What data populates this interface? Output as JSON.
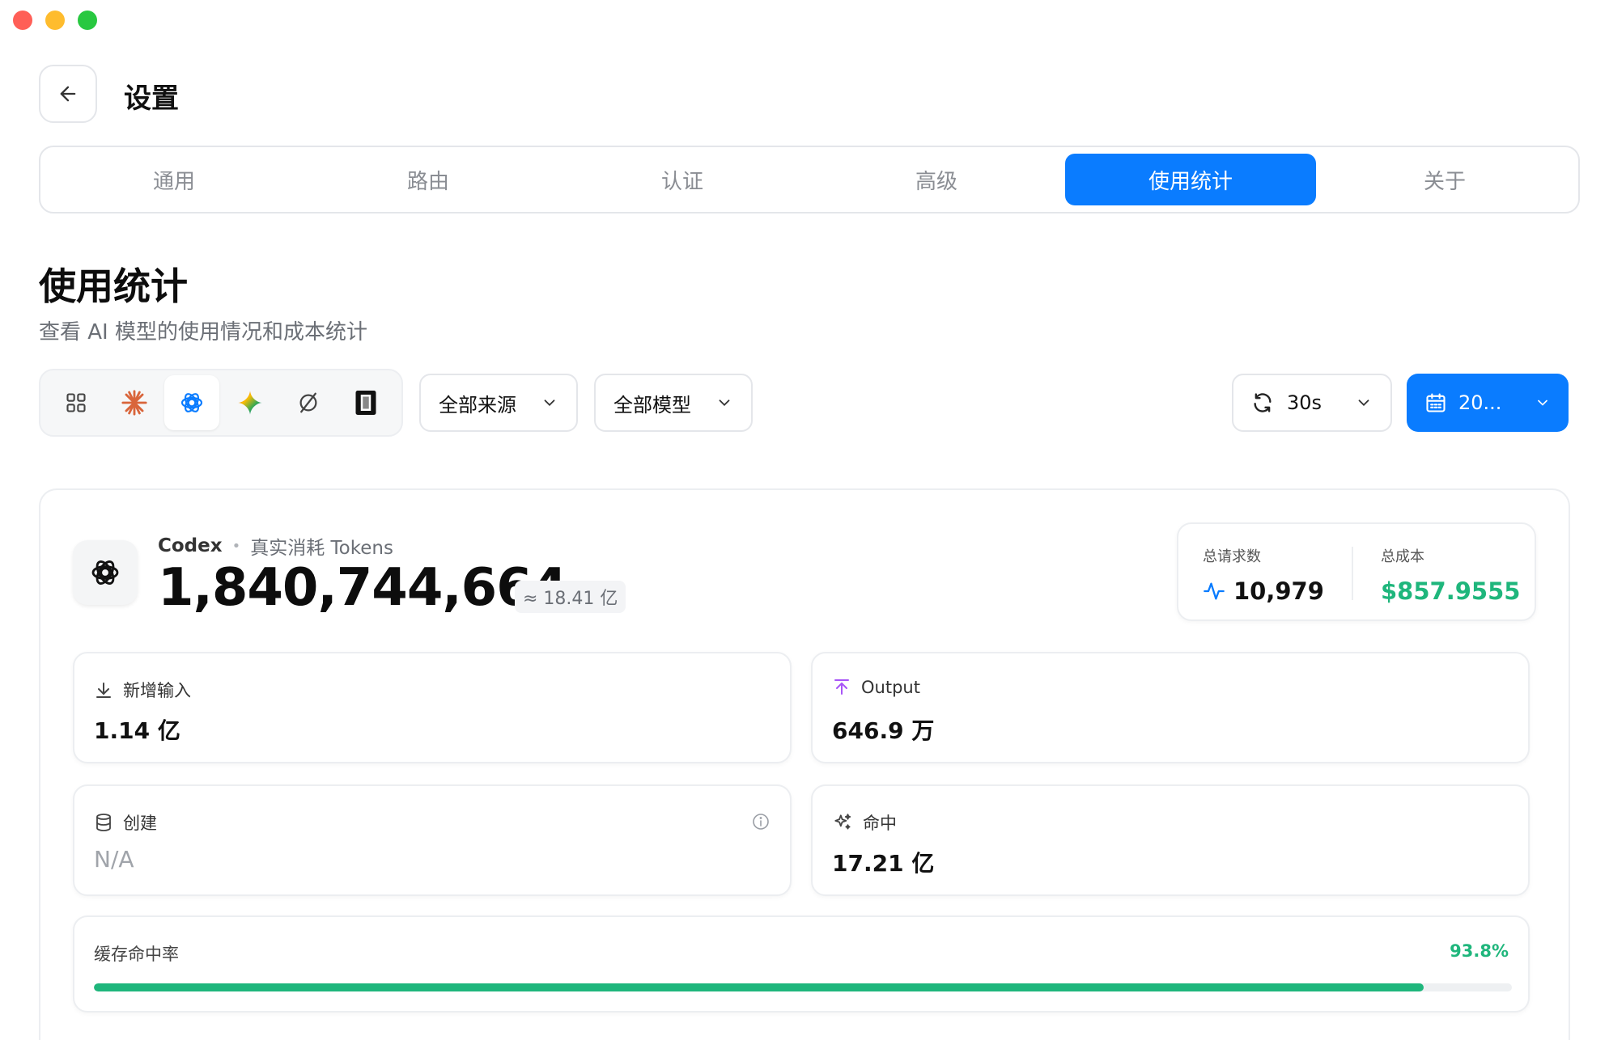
{
  "window": {
    "traffic_lights": {
      "close": "#ff5f57",
      "minimize": "#febc2e",
      "zoom": "#28c840"
    }
  },
  "header": {
    "back_icon": "arrow-left-icon",
    "title": "设置"
  },
  "tabs": [
    {
      "label": "通用",
      "active": false
    },
    {
      "label": "路由",
      "active": false
    },
    {
      "label": "认证",
      "active": false
    },
    {
      "label": "高级",
      "active": false
    },
    {
      "label": "使用统计",
      "active": true
    },
    {
      "label": "关于",
      "active": false
    }
  ],
  "section": {
    "title": "使用统计",
    "subtitle": "查看 AI 模型的使用情况和成本统计"
  },
  "toolbar": {
    "provider_icons": [
      "grid-icon",
      "claude-asterisk-icon",
      "openai-icon",
      "gemini-sparkle-icon",
      "slashed-circle-icon",
      "square-logo-icon"
    ],
    "selected_provider": "openai-icon",
    "source_filter": "全部来源",
    "model_filter": "全部模型",
    "refresh_interval": "30s",
    "date_label": "20..."
  },
  "summary_card": {
    "provider_name": "Codex",
    "provider_desc": "真实消耗 Tokens",
    "total_tokens": "1,840,744,664",
    "approx": "≈ 18.41 亿",
    "total_requests_label": "总请求数",
    "total_requests": "10,979",
    "total_cost_label": "总成本",
    "total_cost": "$857.9555"
  },
  "stats": {
    "input_label": "新增输入",
    "input_value": "1.14 亿",
    "output_label": "Output",
    "output_value": "646.9 万",
    "create_label": "创建",
    "create_value": "N/A",
    "hit_label": "命中",
    "hit_value": "17.21 亿"
  },
  "cache": {
    "label": "缓存命中率",
    "value": "93.8%",
    "fraction": 0.938
  },
  "colors": {
    "accent": "#0a7cff",
    "success": "#1fb67c",
    "output_icon": "#a855f7"
  }
}
